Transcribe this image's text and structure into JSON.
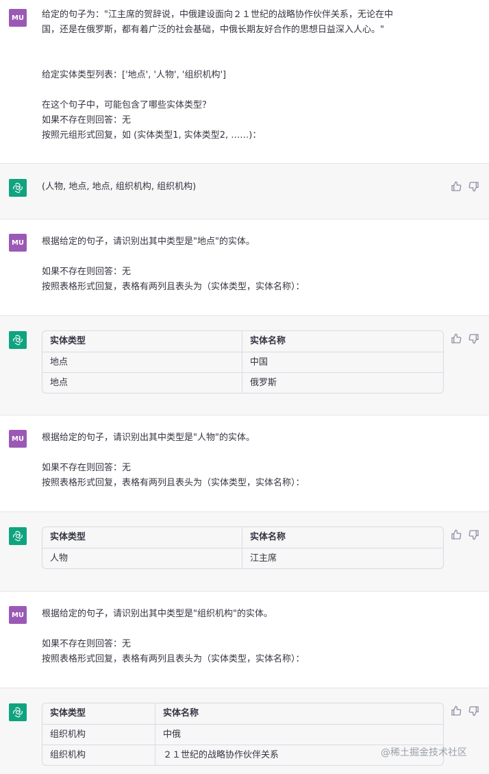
{
  "user_avatar_text": "MU",
  "turns": [
    {
      "role": "user",
      "lines": [
        "给定的句子为：\"江主席的贺辞说，中俄建设面向２１世纪的战略协作伙伴关系，无论在中",
        "国，还是在俄罗斯，都有着广泛的社会基础，中俄长期友好合作的思想日益深入人心。\"",
        "",
        "",
        "给定实体类型列表：['地点', '人物', '组织机构']",
        "",
        "在这个句子中，可能包含了哪些实体类型？",
        "如果不存在则回答：无",
        "按照元组形式回复，如 (实体类型1, 实体类型2, ……)："
      ]
    },
    {
      "role": "assistant",
      "text": "(人物, 地点, 地点, 组织机构, 组织机构)"
    },
    {
      "role": "user",
      "lines": [
        "根据给定的句子，请识别出其中类型是\"地点\"的实体。",
        "",
        "如果不存在则回答：无",
        "按照表格形式回复，表格有两列且表头为（实体类型，实体名称）："
      ]
    },
    {
      "role": "assistant",
      "table": {
        "headers": [
          "实体类型",
          "实体名称"
        ],
        "rows": [
          [
            "地点",
            "中国"
          ],
          [
            "地点",
            "俄罗斯"
          ]
        ]
      }
    },
    {
      "role": "user",
      "lines": [
        "根据给定的句子，请识别出其中类型是\"人物\"的实体。",
        "",
        "如果不存在则回答：无",
        "按照表格形式回复，表格有两列且表头为（实体类型，实体名称）："
      ]
    },
    {
      "role": "assistant",
      "table": {
        "headers": [
          "实体类型",
          "实体名称"
        ],
        "rows": [
          [
            "人物",
            "江主席"
          ]
        ]
      }
    },
    {
      "role": "user",
      "lines": [
        "根据给定的句子，请识别出其中类型是\"组织机构\"的实体。",
        "",
        "如果不存在则回答：无",
        "按照表格形式回复，表格有两列且表头为（实体类型，实体名称）："
      ]
    },
    {
      "role": "assistant",
      "table": {
        "headers": [
          "实体类型",
          "实体名称"
        ],
        "rows": [
          [
            "组织机构",
            "中俄"
          ],
          [
            "组织机构",
            "２１世纪的战略协作伙伴关系"
          ]
        ]
      }
    }
  ],
  "watermark": "@稀土掘金技术社区",
  "colors": {
    "user_avatar": "#9b59b6",
    "assistant_avatar": "#10a37f",
    "assistant_bg": "#f7f7f8"
  },
  "icons": [
    "thumbs-up-icon",
    "thumbs-down-icon",
    "openai-logo-icon"
  ]
}
